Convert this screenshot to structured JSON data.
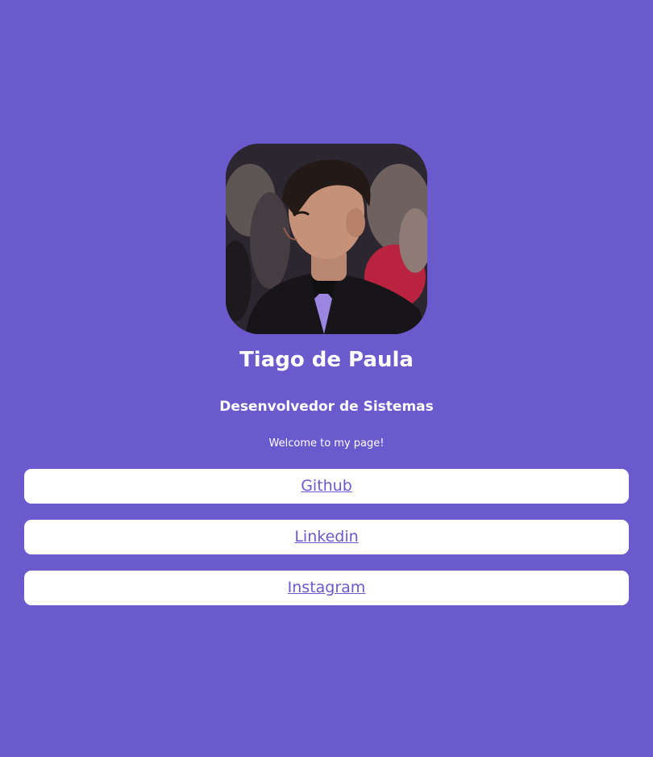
{
  "profile": {
    "name": "Tiago de Paula",
    "role": "Desenvolvedor de Sistemas",
    "welcome": "Welcome to my page!"
  },
  "links": [
    {
      "label": "Github"
    },
    {
      "label": "Linkedin"
    },
    {
      "label": "Instagram"
    }
  ],
  "colors": {
    "background": "#6a5acd",
    "button_bg": "#ffffff",
    "link_text": "#6a5acd",
    "heading_text": "#ffffff"
  }
}
